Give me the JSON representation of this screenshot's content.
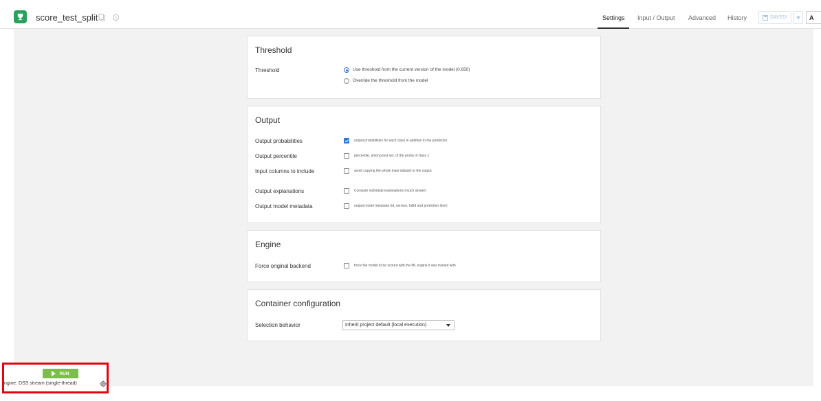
{
  "header": {
    "title": "score_test_split",
    "nav": [
      "Settings",
      "Input / Output",
      "Advanced",
      "History"
    ],
    "active_tab": "Settings",
    "saved_label": "SAVED!",
    "actions_label": "A"
  },
  "threshold": {
    "title": "Threshold",
    "label": "Threshold",
    "options": [
      "Use threshold from the current version of the model (0.650)",
      "Override the threshold from the model"
    ],
    "selected": 0
  },
  "output": {
    "title": "Output",
    "rows": [
      {
        "label": "Output probabilities",
        "text": "output probabilities for each class in addition to the prediction",
        "checked": true
      },
      {
        "label": "Output percentile",
        "text": "percentile, among test set, of the proba of class 1",
        "checked": false
      },
      {
        "label": "Input columns to include",
        "text": "avoid copying the whole input dataset to the output",
        "checked": false
      },
      {
        "label": "Output explanations",
        "text": "Compute individual explanations (much slower)",
        "checked": false
      },
      {
        "label": "Output model metadata",
        "text": "output model metadata (id, version, fullId and prediction time)",
        "checked": false
      }
    ]
  },
  "engine": {
    "title": "Engine",
    "label": "Force original backend",
    "text": "force the model to be scored with the ML engine it was trained with",
    "checked": false
  },
  "container": {
    "title": "Container configuration",
    "label": "Selection behavior",
    "selected": "Inherit project default (local execution)"
  },
  "run": {
    "label": "RUN",
    "engine_text": "ngine: DSS stream (single-thread)"
  },
  "colors": {
    "brand": "#2aa15a",
    "run": "#7bbf4a",
    "highlight": "#e4000f",
    "check": "#2b78d0"
  }
}
